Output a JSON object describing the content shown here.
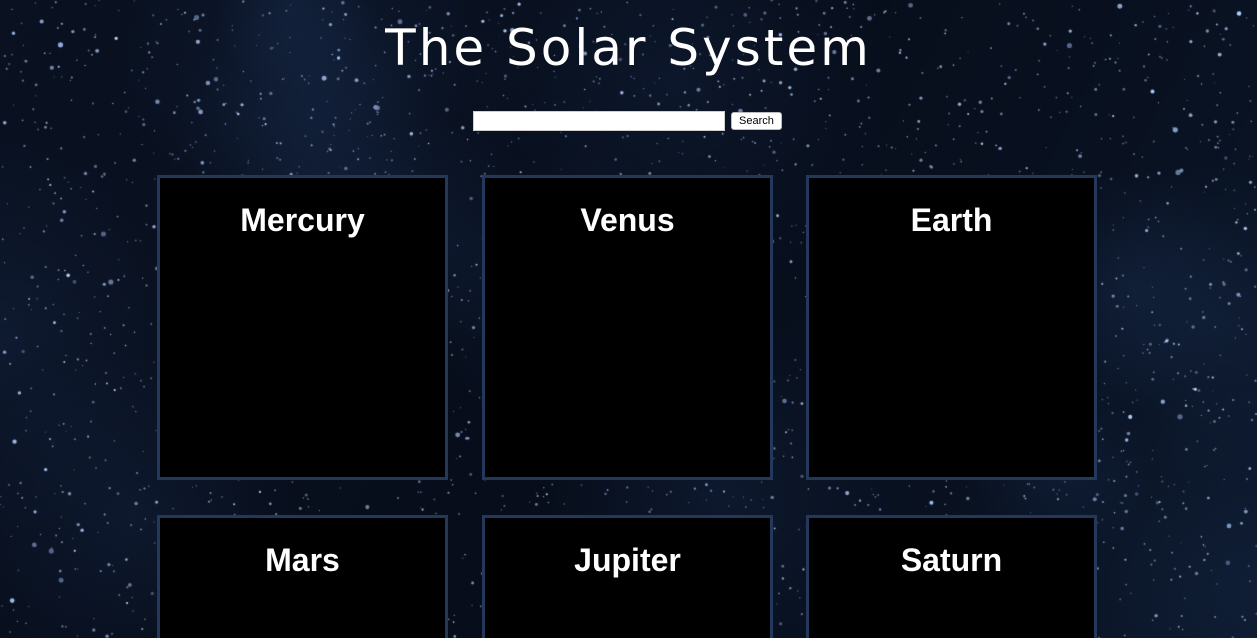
{
  "page": {
    "title": "The Solar System"
  },
  "search": {
    "value": "",
    "placeholder": "",
    "button_label": "Search"
  },
  "planets": [
    {
      "name": "Mercury"
    },
    {
      "name": "Venus"
    },
    {
      "name": "Earth"
    },
    {
      "name": "Mars"
    },
    {
      "name": "Jupiter"
    },
    {
      "name": "Saturn"
    }
  ],
  "colors": {
    "background": "#060b16",
    "card_background": "#000000",
    "card_border": "#23385a",
    "text": "#ffffff"
  }
}
